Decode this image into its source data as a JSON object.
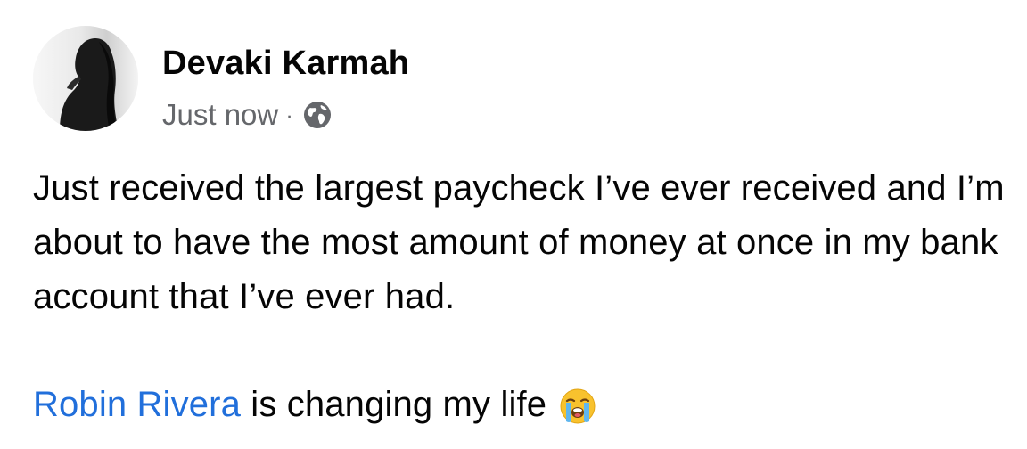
{
  "post": {
    "author_name": "Devaki Karmah",
    "timestamp": "Just now",
    "separator": "·",
    "privacy_icon": "globe-icon",
    "text": "Just received the largest paycheck I’ve ever received and I’m about to have the most amount of money at once in my bank account that I’ve ever had.",
    "mention_name": "Robin Rivera",
    "mention_suffix": " is changing my life",
    "emoji_icon": "loudly-crying-face-icon"
  },
  "colors": {
    "text": "#050505",
    "secondary": "#65676b",
    "mention": "#216fdb"
  }
}
